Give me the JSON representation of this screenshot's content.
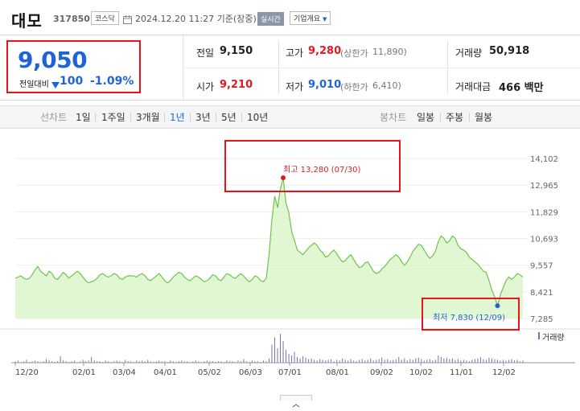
{
  "header": {
    "name": "대모",
    "code": "317850",
    "market": "코스닥",
    "datetime": "2024.12.20 11:27 기준(장중)",
    "live_label": "실시간",
    "company_info_label": "기업개요"
  },
  "price": {
    "current": "9,050",
    "change_label": "전일대비",
    "change_value": "100",
    "change_pct": "-1.09%"
  },
  "stats": {
    "prev_close": {
      "label": "전일",
      "value": "9,150"
    },
    "open": {
      "label": "시가",
      "value": "9,210"
    },
    "high": {
      "label": "고가",
      "value": "9,280",
      "limit_label": "(상한가",
      "limit_value": "11,890)"
    },
    "low": {
      "label": "저가",
      "value": "9,010",
      "limit_label": "(하한가",
      "limit_value": "6,410)"
    },
    "volume": {
      "label": "거래량",
      "value": "50,918"
    },
    "amount": {
      "label": "거래대금",
      "value": "466 백만"
    }
  },
  "toolbar": {
    "line_label": "선차트",
    "periods": [
      "1일",
      "1주일",
      "3개월",
      "1년",
      "3년",
      "5년",
      "10년"
    ],
    "active_period": "1년",
    "candle_label": "봉차트",
    "candle_periods": [
      "일봉",
      "주봉",
      "월봉"
    ]
  },
  "colors": {
    "up": "#e21a22",
    "down": "#1f63d8",
    "line": "#6cc54a",
    "fill": "#d9f5c8",
    "highlight_box": "#e8131b"
  },
  "chart_data": {
    "type": "area",
    "y_ticks": [
      "14,102",
      "12,965",
      "11,829",
      "10,693",
      "9,557",
      "8,421",
      "7,285"
    ],
    "ylim": [
      7285,
      14102
    ],
    "x_ticks": [
      "12/20",
      "02/01",
      "03/04",
      "04/01",
      "05/02",
      "06/03",
      "07/01",
      "08/01",
      "09/02",
      "10/02",
      "11/01",
      "12/02"
    ],
    "annotations": {
      "max": {
        "text": "최고 13,280 (07/30)",
        "value": 13280,
        "date": "07/30"
      },
      "min": {
        "text": "최저 7,830 (12/09)",
        "value": 7830,
        "date": "12/09"
      }
    },
    "series": [
      {
        "values": [
          9000,
          9050,
          9100,
          9000,
          8950,
          9000,
          9150,
          9350,
          9500,
          9300,
          9200,
          9100,
          9300,
          9200,
          9000,
          8950,
          9100,
          9250,
          9150,
          9000,
          9100,
          9200,
          9300,
          9200,
          9050,
          8900,
          8800,
          8850,
          8900,
          9000,
          9150,
          9200,
          9100,
          9050,
          9100,
          9200,
          9150,
          9000,
          8950,
          9050,
          9100,
          9100,
          9100,
          9050,
          9150,
          9200,
          9100,
          8950,
          8900,
          9000,
          9100,
          9200,
          9050,
          8900,
          8800,
          8900,
          9050,
          9150,
          9250,
          9200,
          9050,
          8950,
          8900,
          9000,
          9100,
          9050,
          8950,
          8850,
          8900,
          9000,
          9150,
          9100,
          8950,
          8900,
          9050,
          9200,
          9150,
          9050,
          9000,
          9100,
          9200,
          9100,
          8950,
          8850,
          8950,
          9100,
          9050,
          8900,
          8850,
          9000,
          10000,
          11500,
          12500,
          12000,
          12800,
          13280,
          12200,
          11800,
          11000,
          10600,
          10200,
          10100,
          10000,
          10150,
          10300,
          10400,
          10500,
          10400,
          10200,
          10100,
          9900,
          9950,
          10100,
          10200,
          10050,
          9850,
          9700,
          9750,
          9900,
          10000,
          9800,
          9600,
          9450,
          9500,
          9650,
          9700,
          9500,
          9300,
          9200,
          9250,
          9400,
          9500,
          9650,
          9800,
          9900,
          10000,
          9900,
          9700,
          9550,
          9700,
          9900,
          10150,
          10300,
          10450,
          10400,
          10200,
          10000,
          9850,
          9950,
          10150,
          10550,
          10800,
          10700,
          10500,
          10600,
          10800,
          10700,
          10400,
          10250,
          10200,
          10100,
          9900,
          9800,
          9700,
          9600,
          9450,
          9300,
          9250,
          8900,
          8500,
          8200,
          7830,
          8300,
          8600,
          8900,
          9050,
          8950,
          9050,
          9200,
          9150,
          9050
        ]
      }
    ],
    "volume_label": "거래량",
    "volume": [
      2,
      3,
      1,
      2,
      4,
      1,
      2,
      3,
      2,
      1,
      2,
      5,
      3,
      2,
      1,
      2,
      9,
      3,
      2,
      1,
      2,
      3,
      1,
      2,
      4,
      2,
      3,
      8,
      3,
      2,
      2,
      1,
      3,
      2,
      1,
      2,
      3,
      2,
      1,
      4,
      2,
      2,
      1,
      3,
      2,
      3,
      2,
      4,
      2,
      1,
      2,
      3,
      2,
      2,
      1,
      3,
      2,
      1,
      2,
      3,
      2,
      2,
      1,
      2,
      3,
      2,
      1,
      2,
      3,
      2,
      2,
      1,
      2,
      2,
      1,
      3,
      2,
      2,
      1,
      3,
      2,
      5,
      2,
      1,
      3,
      2,
      2,
      1,
      3,
      2,
      6,
      25,
      35,
      20,
      40,
      30,
      18,
      12,
      10,
      15,
      8,
      6,
      9,
      7,
      5,
      6,
      4,
      3,
      5,
      4,
      3,
      4,
      5,
      2,
      4,
      3,
      6,
      4,
      3,
      5,
      3,
      2,
      4,
      5,
      3,
      4,
      6,
      3,
      4,
      5,
      7,
      4,
      5,
      3,
      4,
      5,
      8,
      4,
      6,
      3,
      5,
      4,
      6,
      7,
      5,
      3,
      4,
      5,
      3,
      4,
      10,
      8,
      6,
      7,
      5,
      6,
      4,
      5,
      3,
      4,
      3,
      2,
      4,
      5,
      6,
      8,
      5,
      4,
      7,
      6,
      5,
      4,
      3,
      4,
      3,
      4,
      5,
      3,
      4,
      2,
      3
    ]
  }
}
